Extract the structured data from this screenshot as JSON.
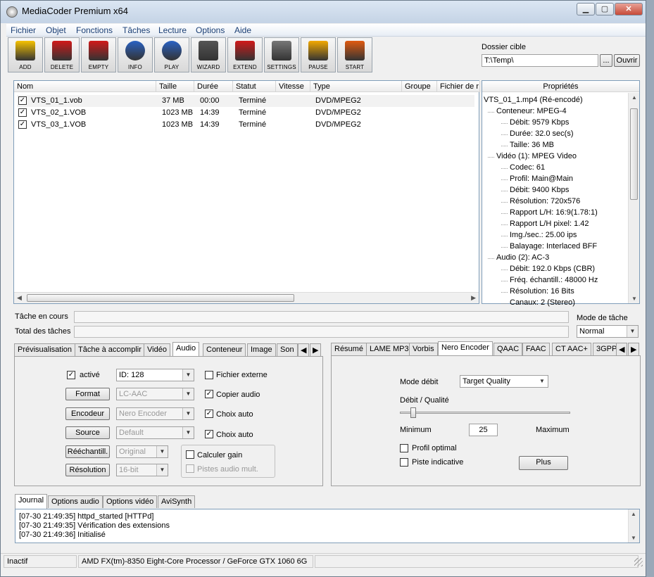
{
  "window": {
    "title": "MediaCoder Premium x64"
  },
  "menu": [
    "Fichier",
    "Objet",
    "Fonctions",
    "Tâches",
    "Lecture",
    "Options",
    "Aide"
  ],
  "toolbar": [
    {
      "label": "ADD",
      "icon": "add-icon",
      "color": "#f5c200"
    },
    {
      "label": "DELETE",
      "icon": "delete-icon",
      "color": "#d11a1a"
    },
    {
      "label": "EMPTY",
      "icon": "empty-icon",
      "color": "#d11a1a"
    },
    {
      "label": "INFO",
      "icon": "info-icon",
      "color": "#2a62c4"
    },
    {
      "label": "PLAY",
      "icon": "play-icon",
      "color": "#2a62c4"
    },
    {
      "label": "WIZARD",
      "icon": "wizard-icon",
      "color": "#555"
    },
    {
      "label": "EXTEND",
      "icon": "extend-icon",
      "color": "#d11a1a"
    },
    {
      "label": "SETTINGS",
      "icon": "settings-icon",
      "color": "#777"
    },
    {
      "label": "PAUSE",
      "icon": "pause-icon",
      "color": "#f2a900"
    },
    {
      "label": "START",
      "icon": "start-icon",
      "color": "#e05a10"
    }
  ],
  "target": {
    "label": "Dossier cible",
    "value": "T:\\Temp\\",
    "browse": "...",
    "open": "Ouvrir"
  },
  "files": {
    "columns": [
      "Nom",
      "Taille",
      "Durée",
      "Statut",
      "Vitesse",
      "Type",
      "Groupe",
      "Fichier de r"
    ],
    "rows": [
      {
        "name": "VTS_01_1.vob",
        "size": "37 MB",
        "duration": "00:00",
        "status": "Terminé",
        "speed": "",
        "type": "DVD/MPEG2"
      },
      {
        "name": "VTS_02_1.VOB",
        "size": "1023 MB",
        "duration": "14:39",
        "status": "Terminé",
        "speed": "",
        "type": "DVD/MPEG2"
      },
      {
        "name": "VTS_03_1.VOB",
        "size": "1023 MB",
        "duration": "14:39",
        "status": "Terminé",
        "speed": "",
        "type": "DVD/MPEG2"
      }
    ]
  },
  "props": {
    "title": "Propriétés",
    "items": [
      "VTS_01_1.mp4 (Ré-encodé)",
      "Conteneur: MPEG-4",
      "Débit: 9579 Kbps",
      "Durée: 32.0 sec(s)",
      "Taille: 36 MB",
      "Vidéo (1): MPEG Video",
      "Codec: 61",
      "Profil: Main@Main",
      "Débit: 9400 Kbps",
      "Résolution: 720x576",
      "Rapport L/H: 16:9(1.78:1)",
      "Rapport L/H pixel: 1.42",
      "Img./sec.: 25.00 ips",
      "Balayage: Interlaced BFF",
      "Audio (2): AC-3",
      "Débit: 192.0 Kbps (CBR)",
      "Fréq. échantill.: 48000 Hz",
      "Résolution: 16 Bits",
      "Canaux: 2 (Stereo)"
    ]
  },
  "progress": {
    "current": "Tâche en cours",
    "total": "Total des tâches",
    "mode_label": "Mode de tâche",
    "mode_value": "Normal"
  },
  "left_tabs": [
    "Prévisualisation",
    "Tâche à accomplir",
    "Vidéo",
    "Audio",
    "Conteneur",
    "Image",
    "Son"
  ],
  "audio": {
    "active": "activé",
    "id": "ID: 128",
    "external": "Fichier externe",
    "format_btn": "Format",
    "format_val": "LC-AAC",
    "copy": "Copier audio",
    "encoder_btn": "Encodeur",
    "encoder_val": "Nero Encoder",
    "auto1": "Choix auto",
    "source_btn": "Source",
    "source_val": "Default",
    "auto2": "Choix auto",
    "resample_btn": "Rééchantill.",
    "resample_val": "Original",
    "gain": "Calculer gain",
    "resolution_btn": "Résolution",
    "resolution_val": "16-bit",
    "multi": "Pistes audio mult."
  },
  "right_tabs": [
    "Résumé",
    "LAME MP3",
    "Vorbis",
    "Nero Encoder",
    "QAAC",
    "FAAC",
    "CT AAC+",
    "3GPP"
  ],
  "nero": {
    "mode_label": "Mode débit",
    "mode_value": "Target Quality",
    "quality_label": "Débit / Qualité",
    "slider": 0.08,
    "min": "Minimum",
    "max": "Maximum",
    "value": "25",
    "optimal": "Profil optimal",
    "hint": "Piste indicative",
    "more": "Plus"
  },
  "log_tabs": [
    "Journal",
    "Options audio",
    "Options vidéo",
    "AviSynth"
  ],
  "log": [
    "[07-30 21:49:35] httpd_started [HTTPd]",
    "[07-30 21:49:35] Vérification des extensions",
    "[07-30 21:49:36] Initialisé"
  ],
  "status": {
    "state": "Inactif",
    "hw": "AMD FX(tm)-8350 Eight-Core Processor  / GeForce GTX 1060 6G"
  }
}
